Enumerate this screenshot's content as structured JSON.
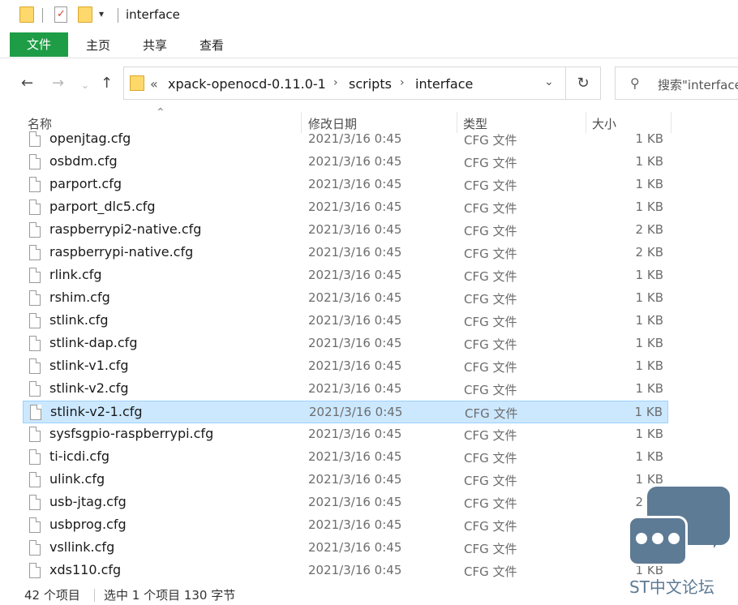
{
  "window": {
    "title": "interface"
  },
  "ribbon": {
    "tabs": [
      "文件",
      "主页",
      "共享",
      "查看"
    ]
  },
  "address": {
    "overflow": "«",
    "crumbs": [
      "xpack-openocd-0.11.0-1",
      "scripts",
      "interface"
    ],
    "separator": "›"
  },
  "search": {
    "placeholder": "搜索\"interface\""
  },
  "columns": {
    "name": "名称",
    "date": "修改日期",
    "type": "类型",
    "size": "大小"
  },
  "files": [
    {
      "name": "openjtag.cfg",
      "date": "2021/3/16 0:45",
      "type": "CFG 文件",
      "size": "1 KB"
    },
    {
      "name": "osbdm.cfg",
      "date": "2021/3/16 0:45",
      "type": "CFG 文件",
      "size": "1 KB"
    },
    {
      "name": "parport.cfg",
      "date": "2021/3/16 0:45",
      "type": "CFG 文件",
      "size": "1 KB"
    },
    {
      "name": "parport_dlc5.cfg",
      "date": "2021/3/16 0:45",
      "type": "CFG 文件",
      "size": "1 KB"
    },
    {
      "name": "raspberrypi2-native.cfg",
      "date": "2021/3/16 0:45",
      "type": "CFG 文件",
      "size": "2 KB"
    },
    {
      "name": "raspberrypi-native.cfg",
      "date": "2021/3/16 0:45",
      "type": "CFG 文件",
      "size": "2 KB"
    },
    {
      "name": "rlink.cfg",
      "date": "2021/3/16 0:45",
      "type": "CFG 文件",
      "size": "1 KB"
    },
    {
      "name": "rshim.cfg",
      "date": "2021/3/16 0:45",
      "type": "CFG 文件",
      "size": "1 KB"
    },
    {
      "name": "stlink.cfg",
      "date": "2021/3/16 0:45",
      "type": "CFG 文件",
      "size": "1 KB"
    },
    {
      "name": "stlink-dap.cfg",
      "date": "2021/3/16 0:45",
      "type": "CFG 文件",
      "size": "1 KB"
    },
    {
      "name": "stlink-v1.cfg",
      "date": "2021/3/16 0:45",
      "type": "CFG 文件",
      "size": "1 KB"
    },
    {
      "name": "stlink-v2.cfg",
      "date": "2021/3/16 0:45",
      "type": "CFG 文件",
      "size": "1 KB"
    },
    {
      "name": "stlink-v2-1.cfg",
      "date": "2021/3/16 0:45",
      "type": "CFG 文件",
      "size": "1 KB",
      "selected": true
    },
    {
      "name": "sysfsgpio-raspberrypi.cfg",
      "date": "2021/3/16 0:45",
      "type": "CFG 文件",
      "size": "1 KB"
    },
    {
      "name": "ti-icdi.cfg",
      "date": "2021/3/16 0:45",
      "type": "CFG 文件",
      "size": "1 KB"
    },
    {
      "name": "ulink.cfg",
      "date": "2021/3/16 0:45",
      "type": "CFG 文件",
      "size": "1 KB"
    },
    {
      "name": "usb-jtag.cfg",
      "date": "2021/3/16 0:45",
      "type": "CFG 文件",
      "size": "2 KB"
    },
    {
      "name": "usbprog.cfg",
      "date": "2021/3/16 0:45",
      "type": "CFG 文件",
      "size": "1 KB"
    },
    {
      "name": "vsllink.cfg",
      "date": "2021/3/16 0:45",
      "type": "CFG 文件",
      "size": "1 KB"
    },
    {
      "name": "xds110.cfg",
      "date": "2021/3/16 0:45",
      "type": "CFG 文件",
      "size": "1 KB"
    }
  ],
  "status": {
    "count": "42 个项目",
    "selection": "选中 1 个项目  130 字节"
  },
  "watermark": {
    "text": "ST中文论坛"
  },
  "colors": {
    "ribbon_file_bg": "#1e9d46",
    "selected_row": "#cce8ff",
    "watermark": "#5e7b95"
  }
}
